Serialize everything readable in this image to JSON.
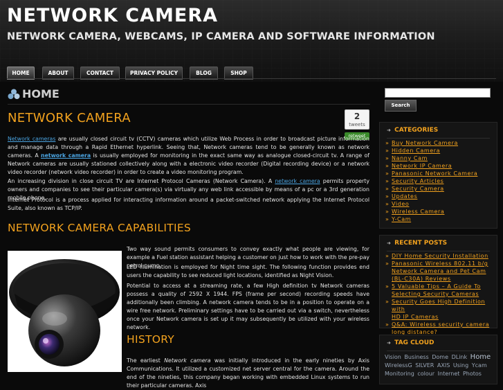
{
  "site": {
    "title": "NETWORK CAMERA",
    "description": "NETWORK CAMERA, WEBCAMS, IP CAMERA AND SOFTWARE INFORMATION"
  },
  "nav": {
    "items": [
      {
        "label": "HOME"
      },
      {
        "label": "ABOUT"
      },
      {
        "label": "CONTACT"
      },
      {
        "label": "PRIVACY POLICY"
      },
      {
        "label": "BLOG"
      },
      {
        "label": "SHOP"
      }
    ]
  },
  "page": {
    "heading": "HOME",
    "article_title": "NETWORK CAMERA",
    "tweet": {
      "count": "2",
      "count_label": "tweets",
      "button": "retweet"
    },
    "intro": {
      "p1_link": "Network cameras",
      "p1_a": " are usually closed circuit tv (CCTV) cameras which utilize Web Process in order to broadcast picture information and manage data through a Rapid Ethernet hyperlink. Seeing that, Network cameras tend to be generally known as network cameras. A ",
      "p1_link2": "network camera",
      "p1_b": " is usually employed for monitoring in the exact same way as analogue closed-circuit tv. A range of Network cameras are usually  stationed collectively along with a electronic video recorder (Digital recording device) or a network video recorder (network video recorder) in order to create a video monitoring program.",
      "p2_a": "An increasing division in close circuit TV are Internet Protocol Cameras (Network Camera). A ",
      "p2_link": "network camera",
      "p2_b": " permits property owners and companies to see their particular camera(s) via virtually any web link accessible by means of a pc or a 3rd generation mobile phone.",
      "p3": "Internet Protocol is a process applied for interacting information around a packet-switched network applying the Internet Protocol Suite, also known as TCP/IP."
    },
    "capabilities": {
      "title": "NETWORK CAMERA CAPABILITIES",
      "p1": "Two way sound permits consumers to convey exactly what people are viewing, for example a Fuel station assistant helping a customer on just how to work with the pre-pay petrol pump.",
      "p2": "LED illumination is employed for Night time sight. The following function provides end users the capability to see reduced light locations, identified as Night Vision.",
      "p3": "Potential to access at a streaming rate, a few High definition tv Network cameras possess a quality of 2592 X 1944. FPS (frame per second) recording speeds have additionally been climbing. A network camera tends to be in a position to operate on a wire free network. Preliminary settings have to be carried out via a switch, nevertheless once your Network camera is set up it may subsequently be utilized with your wireless network."
    },
    "history": {
      "title": "HISTORY",
      "p1_a": "The earliest ",
      "p1_em": "Network camera",
      "p1_b": " was initially introduced in the early nineties by Axis Communications. It utilized a customized net server central for the camera. Around the end of the nineties, this company began working with embedded Linux systems to run their particular cameras. Axis"
    }
  },
  "sidebar": {
    "search_button": "Search",
    "categories": {
      "title": "CATEGORIES",
      "items": [
        "Buy Network Camera",
        "Hidden Camera",
        "Nanny Cam",
        "Network IP Camera",
        "Panasonic Network Camera",
        "Security Articles",
        "Security Camera",
        "Updates",
        "Video",
        "Wireless Camera",
        "Y-Cam"
      ]
    },
    "recent_posts": {
      "title": "RECENT POSTS",
      "items": [
        [
          "DIY Home Security Installation"
        ],
        [
          "Panasonic Wireless 802.11 b/g",
          "Network Camera and Pet Cam",
          "(BL-C30A) Reviews"
        ],
        [
          "5 Valuable Tips – A Guide To",
          "Selecting Security Cameras"
        ],
        [
          "Security Goes High Definition with",
          "HD IP Cameras"
        ],
        [
          "Q&A: Wireless security camera",
          "long distance?"
        ]
      ]
    },
    "tag_cloud": {
      "title": "TAG CLOUD",
      "tags": [
        "Vision",
        "Business",
        "Dome",
        "DLink",
        "Home",
        "WirelessG",
        "SILVER",
        "AXIS",
        "Using",
        "Ycam",
        "Monitoring",
        "colour",
        "Internet",
        "Photos"
      ]
    }
  },
  "colors": {
    "accent": "#f2a21e",
    "link": "#4aa3e0",
    "background": "#0a0a0a",
    "retweet": "#3a8a2a"
  }
}
